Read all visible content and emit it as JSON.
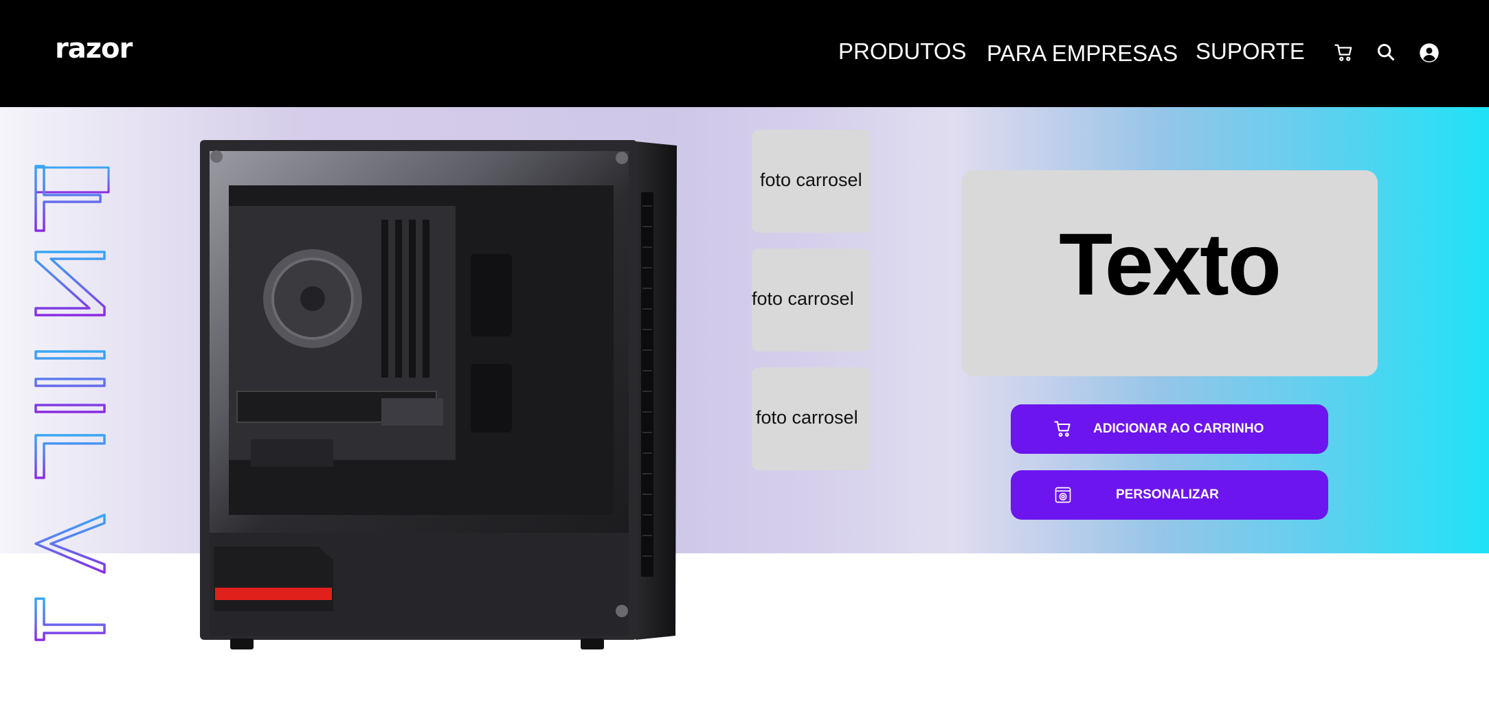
{
  "header": {
    "logo": "razor",
    "nav": [
      "PRODUTOS",
      "PARA EMPRESAS",
      "SUPORTE"
    ],
    "icons": [
      "cart-icon",
      "search-icon",
      "user-icon"
    ]
  },
  "hero": {
    "side_word": "TALENT",
    "carousel": [
      "foto carrosel",
      "foto carrosel",
      "foto carrosel"
    ],
    "text_card": "Texto",
    "buttons": {
      "add_to_cart": "ADICIONAR AO CARRINHO",
      "customize": "PERSONALIZAR"
    }
  },
  "colors": {
    "header_bg": "#000000",
    "button_bg": "#6c15ef",
    "card_bg": "#d9d9d9",
    "gradient_end": "#1fe2f6"
  }
}
